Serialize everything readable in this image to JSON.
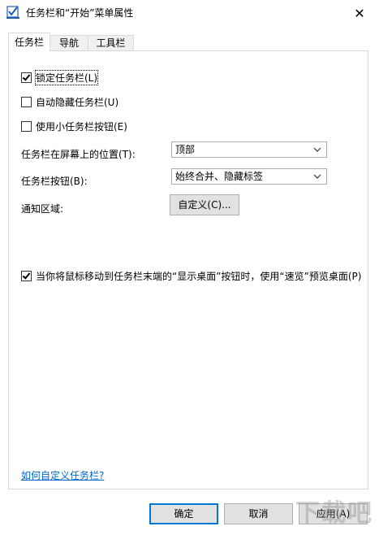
{
  "window": {
    "title": "任务栏和“开始”菜单属性",
    "close_glyph": "✕"
  },
  "tabs": [
    {
      "label": "任务栏",
      "active": true
    },
    {
      "label": "导航",
      "active": false
    },
    {
      "label": "工具栏",
      "active": false
    }
  ],
  "options": {
    "lock_taskbar": {
      "label": "锁定任务栏(L)",
      "checked": true
    },
    "auto_hide": {
      "label": "自动隐藏任务栏(U)",
      "checked": false
    },
    "small_buttons": {
      "label": "使用小任务栏按钮(E)",
      "checked": false
    },
    "peek": {
      "label": "当你将鼠标移动到任务栏末端的“显示桌面”按钮时，使用“速览”预览桌面(P)",
      "checked": true
    }
  },
  "position": {
    "label": "任务栏在屏幕上的位置(T):",
    "value": "顶部"
  },
  "buttons_setting": {
    "label": "任务栏按钮(B):",
    "value": "始终合并、隐藏标签"
  },
  "notification": {
    "label": "通知区域:",
    "button_label": "自定义(C)..."
  },
  "help_link": "如何自定义任务栏?",
  "footer": {
    "ok_label": "确定",
    "cancel_label": "取消",
    "apply_label": "应用(A)"
  },
  "watermark": {
    "text": "下载吧"
  },
  "icons": {
    "app": "taskbar-checkbox-icon",
    "chevron": "chevron-down-icon",
    "close": "close-icon"
  }
}
